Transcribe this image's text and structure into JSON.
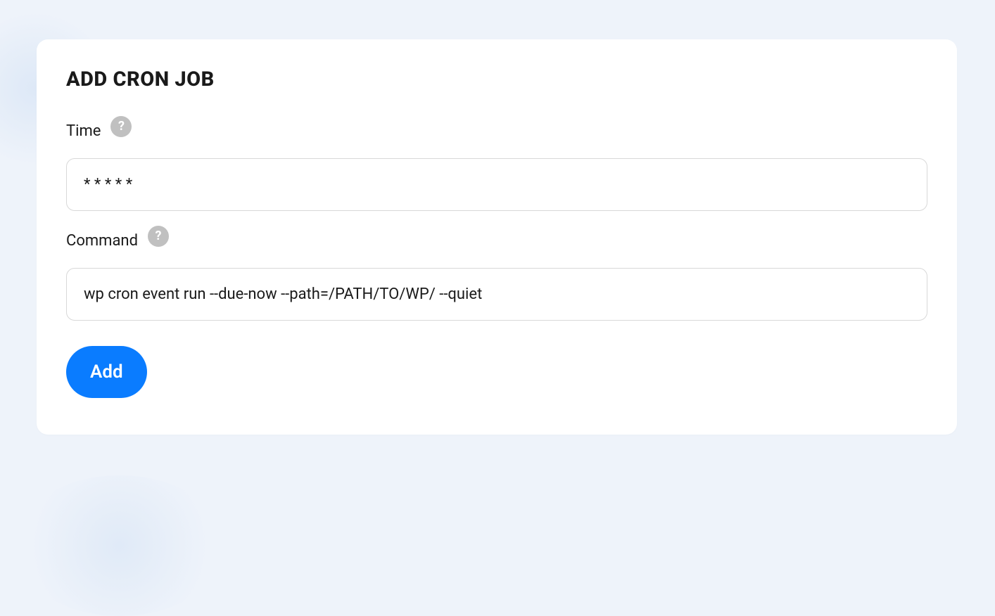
{
  "card": {
    "title": "ADD CRON JOB"
  },
  "fields": {
    "time": {
      "label": "Time",
      "value": "* * * * *",
      "help_icon": "?"
    },
    "command": {
      "label": "Command",
      "value": "wp cron event run --due-now --path=/PATH/TO/WP/ --quiet",
      "help_icon": "?"
    }
  },
  "buttons": {
    "add": "Add"
  }
}
